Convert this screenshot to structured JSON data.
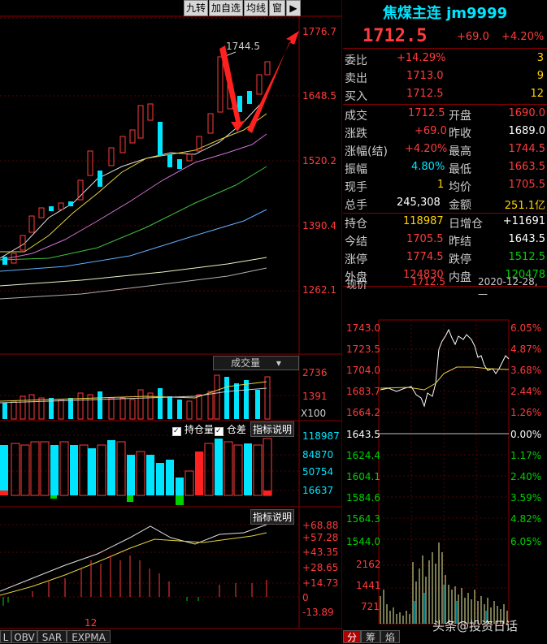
{
  "toolbar": {
    "buttons": [
      "九转",
      "加自选",
      "均线",
      "窗"
    ]
  },
  "kline": {
    "price_axis": [
      "1776.7",
      "1648.5",
      "1520.2",
      "1390.4",
      "1262.1"
    ],
    "high_marker": "1744.5",
    "volume_axis": [
      "2736",
      "1391"
    ],
    "volume_unit": "X100",
    "volume_label": "成交量",
    "oi_checkbox1": "持仓量",
    "oi_checkbox2": "仓差",
    "oi_help": "指标说明",
    "oi_axis": [
      "118987",
      "84870",
      "50754",
      "16637"
    ],
    "macd_help": "指标说明",
    "macd_axis": [
      "+68.88",
      "+57.28",
      "+43.35",
      "+28.65",
      "+14.73",
      "0",
      "-13.89"
    ],
    "x_label": "12"
  },
  "bottom_tabs": [
    "L",
    "OBV",
    "SAR",
    "EXPMA"
  ],
  "quote": {
    "title": "焦煤主连 jm9999",
    "last": "1712.5",
    "change": "+69.0",
    "change_pct": "+4.20%",
    "rows_a": [
      {
        "label": "委比",
        "value": "+14.29%",
        "extra": "3"
      },
      {
        "label": "卖出",
        "value": "1713.0",
        "extra": "9"
      },
      {
        "label": "买入",
        "value": "1712.5",
        "extra": "12"
      }
    ],
    "rows_b": [
      {
        "l1": "成交",
        "v1": "1712.5",
        "l2": "开盘",
        "v2": "1690.0"
      },
      {
        "l1": "涨跌",
        "v1": "+69.0",
        "l2": "昨收",
        "v2": "1689.0"
      },
      {
        "l1": "涨幅(结)",
        "v1": "+4.20%",
        "l2": "最高",
        "v2": "1744.5"
      },
      {
        "l1": "振幅",
        "v1": "4.80%",
        "l2": "最低",
        "v2": "1663.5"
      },
      {
        "l1": "现手",
        "v1": "1",
        "l2": "均价",
        "v2": "1705.5"
      },
      {
        "l1": "总手",
        "v1": "245,308",
        "l2": "金额",
        "v2": "251.1亿"
      }
    ],
    "rows_c": [
      {
        "l1": "持仓",
        "v1": "118987",
        "l2": "日增仓",
        "v2": "+11691"
      },
      {
        "l1": "今结",
        "v1": "1705.5",
        "l2": "昨结",
        "v2": "1643.5"
      },
      {
        "l1": "涨停",
        "v1": "1774.5",
        "l2": "跌停",
        "v2": "1512.5"
      },
      {
        "l1": "外盘",
        "v1": "124830",
        "l2": "内盘",
        "v2": "120478"
      }
    ],
    "intraday_header": {
      "label": "现价",
      "price": "1712.5",
      "date": "2020-12-28,一"
    }
  },
  "intraday": {
    "left_axis": [
      "1743.0",
      "1723.5",
      "1704.0",
      "1683.7",
      "1664.2",
      "1643.5",
      "1624.4",
      "1604.1",
      "1584.6",
      "1564.3",
      "1544.0"
    ],
    "right_axis": [
      "6.05%",
      "4.87%",
      "3.68%",
      "2.44%",
      "1.26%",
      "0.00%",
      "1.17%",
      "2.40%",
      "3.59%",
      "4.82%",
      "6.05%"
    ],
    "vol_axis": [
      "2162",
      "1441",
      "721"
    ]
  },
  "side_tabs": [
    "分",
    "筹",
    "焰"
  ],
  "watermark": "头条@投资日话"
}
